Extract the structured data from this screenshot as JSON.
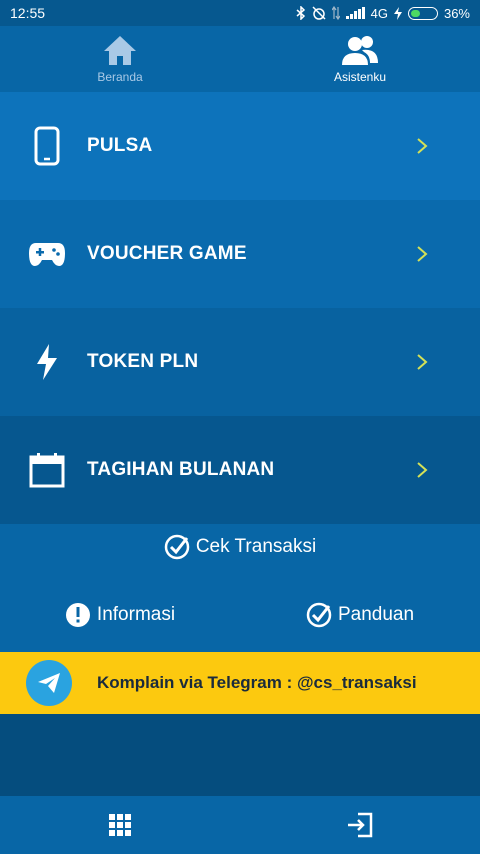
{
  "status_bar": {
    "time": "12:55",
    "network": "4G",
    "battery": "36%"
  },
  "top_nav": {
    "tabs": [
      {
        "label": "Beranda",
        "icon": "home-icon",
        "active": false
      },
      {
        "label": "Asistenku",
        "icon": "users-icon",
        "active": true
      }
    ]
  },
  "menu": {
    "items": [
      {
        "label": "PULSA",
        "icon": "phone-icon"
      },
      {
        "label": "VOUCHER GAME",
        "icon": "gamepad-icon"
      },
      {
        "label": "TOKEN PLN",
        "icon": "lightning-icon"
      },
      {
        "label": "TAGIHAN BULANAN",
        "icon": "calendar-icon"
      }
    ]
  },
  "actions": {
    "cek_transaksi": "Cek Transaksi",
    "informasi": "Informasi",
    "panduan": "Panduan"
  },
  "banner": {
    "text": "Komplain via Telegram : @cs_transaksi",
    "icon": "telegram-icon"
  },
  "bottom_bar": {
    "left_icon": "grid-icon",
    "right_icon": "logout-icon"
  },
  "colors": {
    "accent": "#0866a6",
    "banner": "#fcc90f",
    "chevron": "#d4e157"
  }
}
